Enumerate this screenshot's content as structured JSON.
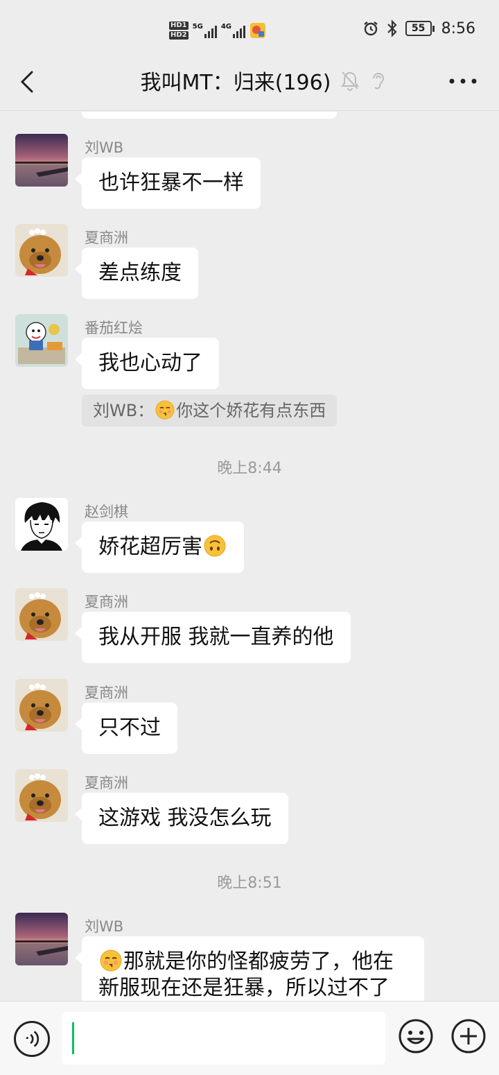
{
  "status_bar": {
    "hd1": "HD1",
    "hd2": "HD2",
    "net1": "5G",
    "net2": "4G",
    "battery": "55",
    "time": "8:56"
  },
  "header": {
    "title": "我叫MT：归来(196)"
  },
  "messages": [
    {
      "sender": "刘WB",
      "text": "也许狂暴不一样",
      "avatar": "sunset-avatar"
    },
    {
      "sender": "夏商洲",
      "text": "差点练度",
      "avatar": "dog-avatar"
    },
    {
      "sender": "番茄红烩",
      "text": "我也心动了",
      "avatar": "cartoon-avatar",
      "quote": "刘WB：",
      "quote_text": "你这个娇花有点东西"
    },
    {
      "time": "晚上8:44"
    },
    {
      "sender": "赵剑棋",
      "text": "娇花超厉害",
      "avatar": "anime-avatar"
    },
    {
      "sender": "夏商洲",
      "text": "我从开服 我就一直养的他",
      "avatar": "dog-avatar"
    },
    {
      "sender": "夏商洲",
      "text": "只不过",
      "avatar": "dog-avatar"
    },
    {
      "sender": "夏商洲",
      "text": "这游戏 我没怎么玩",
      "avatar": "dog-avatar"
    },
    {
      "time": "晚上8:51"
    },
    {
      "sender": "刘WB",
      "text_line1": "那就是你的怪都疲劳了，他在",
      "text_line2": "新服现在还是狂暴，所以过不了",
      "avatar": "sunset-avatar"
    }
  ],
  "input": {
    "value": ""
  },
  "colors": {
    "background": "#ededed",
    "bubble": "#ffffff",
    "cursor": "#07c160"
  }
}
